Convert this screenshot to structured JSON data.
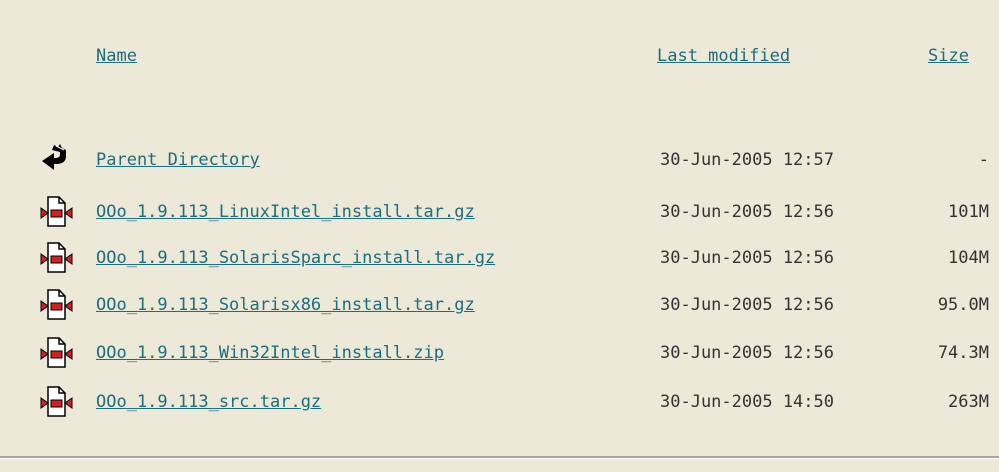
{
  "headers": {
    "name": "Name",
    "last_modified": "Last modified",
    "size": "Size"
  },
  "rows": [
    {
      "name": "Parent Directory",
      "modified": "30-Jun-2005 12:57",
      "size": "-",
      "icon": "back-arrow-icon"
    },
    {
      "name": "OOo_1.9.113_LinuxIntel_install.tar.gz",
      "modified": "30-Jun-2005 12:56",
      "size": "101M",
      "icon": "compressed-file-icon"
    },
    {
      "name": "OOo_1.9.113_SolarisSparc_install.tar.gz",
      "modified": "30-Jun-2005 12:56",
      "size": "104M",
      "icon": "compressed-file-icon"
    },
    {
      "name": "OOo_1.9.113_Solarisx86_install.tar.gz",
      "modified": "30-Jun-2005 12:56",
      "size": "95.0M",
      "icon": "compressed-file-icon"
    },
    {
      "name": "OOo_1.9.113_Win32Intel_install.zip",
      "modified": "30-Jun-2005 12:56",
      "size": "74.3M",
      "icon": "compressed-file-icon"
    },
    {
      "name": "OOo_1.9.113_src.tar.gz",
      "modified": "30-Jun-2005 14:50",
      "size": "263M",
      "icon": "compressed-file-icon"
    }
  ],
  "colors": {
    "background": "#ece9d8",
    "link": "#1c6d7e",
    "text": "#333333",
    "icon_red": "#d42020"
  }
}
